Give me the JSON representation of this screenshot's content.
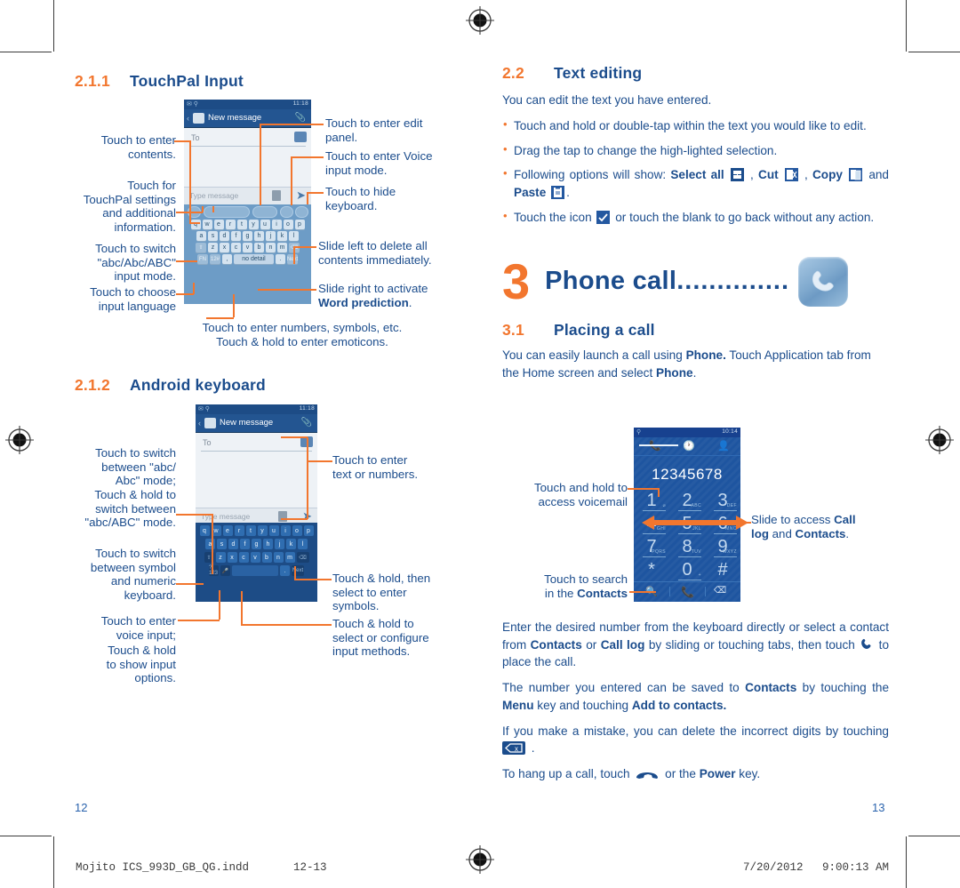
{
  "marks": {
    "registration": "registration-crosshair"
  },
  "left_column": {
    "section1": {
      "number": "2.1.1",
      "title": "TouchPal Input"
    },
    "section2": {
      "number": "2.1.2",
      "title": "Android keyboard"
    },
    "touchpal_phone": {
      "status_time": "11:18",
      "title": "New message",
      "to_placeholder": "To",
      "type_placeholder": "Type message",
      "keys_row1": [
        "q",
        "w",
        "e",
        "r",
        "t",
        "y",
        "u",
        "i",
        "o",
        "p"
      ],
      "keys_row2": [
        "a",
        "s",
        "d",
        "f",
        "g",
        "h",
        "j",
        "k",
        "l"
      ],
      "keys_row3": [
        "z",
        "x",
        "c",
        "v",
        "b",
        "n",
        "m"
      ],
      "key_fn": "FN",
      "key_123": "12#",
      "key_next": "Next",
      "key_space": "no detail"
    },
    "android_phone": {
      "status_time": "11:18",
      "title": "New message",
      "to_placeholder": "To",
      "type_placeholder": "Type message",
      "keys_row1": [
        "q",
        "w",
        "e",
        "r",
        "t",
        "y",
        "u",
        "i",
        "o",
        "p"
      ],
      "keys_row2": [
        "a",
        "s",
        "d",
        "f",
        "g",
        "h",
        "j",
        "k",
        "l"
      ],
      "keys_row3": [
        "z",
        "x",
        "c",
        "v",
        "b",
        "n",
        "m"
      ],
      "key_sym": "?123",
      "key_next": "Next",
      "key_period": "."
    },
    "callouts": [
      {
        "id": "enter-contents",
        "text": "Touch to enter\ncontents."
      },
      {
        "id": "touchpal-settings",
        "text": "Touch for\nTouchPal settings\nand additional\ninformation."
      },
      {
        "id": "switch-abc",
        "text": "Touch to switch\n\"abc/Abc/ABC\"\ninput mode."
      },
      {
        "id": "choose-language",
        "text": "Touch to choose\ninput language"
      },
      {
        "id": "enter-edit-panel",
        "text": "Touch to enter edit\npanel."
      },
      {
        "id": "voice-input-mode",
        "text": "Touch to enter Voice\ninput mode."
      },
      {
        "id": "hide-keyboard",
        "text": "Touch to hide\nkeyboard."
      },
      {
        "id": "slide-left-delete",
        "text": "Slide left to delete all\ncontents immediately."
      },
      {
        "id": "slide-right-word",
        "text": "Slide right to activate"
      },
      {
        "id": "slide-right-word-bold",
        "text": "Word prediction"
      },
      {
        "id": "numbers-symbols-1",
        "text": "Touch to enter numbers, symbols, etc."
      },
      {
        "id": "numbers-symbols-2",
        "text": "Touch & hold to enter emoticons."
      },
      {
        "id": "switch-abc-android",
        "text": "Touch to switch\nbetween \"abc/\nAbc\" mode;\nTouch & hold to\nswitch between\n\"abc/ABC\" mode."
      },
      {
        "id": "switch-symbol-numeric",
        "text": "Touch to switch\nbetween symbol\nand numeric\nkeyboard."
      },
      {
        "id": "voice-input",
        "text": "Touch to enter\nvoice input;"
      },
      {
        "id": "show-input-options",
        "text": "Touch & hold\nto show input\noptions."
      },
      {
        "id": "enter-text-numbers",
        "text": "Touch to enter\ntext or numbers."
      },
      {
        "id": "hold-select-symbols",
        "text": "Touch & hold, then\nselect to enter\nsymbols."
      },
      {
        "id": "configure-input",
        "text": "Touch & hold to\nselect or configure\ninput methods."
      }
    ]
  },
  "right_column": {
    "section_text_editing": {
      "number": "2.2",
      "title": "Text editing"
    },
    "intro": "You can edit the text you have entered.",
    "bullets": [
      {
        "parts": [
          {
            "t": "Touch and hold or double-tap within the text you would like to edit.",
            "b": false
          }
        ]
      },
      {
        "parts": [
          {
            "t": "Drag the tap to change the high-lighted selection.",
            "b": false
          }
        ]
      },
      {
        "parts": [
          {
            "t": "Following options will show: ",
            "b": false
          },
          {
            "t": "Select all",
            "b": true
          },
          {
            "t": " ",
            "b": false
          },
          {
            "icon": "select-all-icon"
          },
          {
            "t": " , ",
            "b": false
          },
          {
            "t": "Cut",
            "b": true
          },
          {
            "t": " ",
            "b": false
          },
          {
            "icon": "cut-icon"
          },
          {
            "t": " , ",
            "b": false
          },
          {
            "t": "Copy",
            "b": true
          },
          {
            "t": " ",
            "b": false
          },
          {
            "icon": "copy-icon"
          },
          {
            "t": " and ",
            "b": false
          },
          {
            "t": "Paste",
            "b": true
          },
          {
            "t": " ",
            "b": false
          },
          {
            "icon": "paste-icon"
          },
          {
            "t": ".",
            "b": false
          }
        ]
      },
      {
        "parts": [
          {
            "t": "Touch the icon ",
            "b": false
          },
          {
            "icon": "check-icon"
          },
          {
            "t": " or touch the blank to go back without any action.",
            "b": false
          }
        ]
      }
    ],
    "chapter": {
      "number": "3",
      "title": "Phone call",
      "dots": "..............",
      "icon": "phone-handset-icon"
    },
    "section_placing": {
      "number": "3.1",
      "title": "Placing a call"
    },
    "placing_intro_parts": [
      {
        "t": "You can easily launch a call using ",
        "b": false
      },
      {
        "t": "Phone.",
        "b": true
      },
      {
        "t": " Touch Application tab from the Home screen and select ",
        "b": false
      },
      {
        "t": "Phone",
        "b": true
      },
      {
        "t": ".",
        "b": false
      }
    ],
    "dialer": {
      "status_time": "10:14",
      "tabs": [
        "phone-icon",
        "clock-icon",
        "contacts-icon"
      ],
      "number": "12345678",
      "keys": [
        {
          "d": "1",
          "s": "⌀"
        },
        {
          "d": "2",
          "s": "ABC"
        },
        {
          "d": "3",
          "s": "DEF"
        },
        {
          "d": "4",
          "s": "GHI"
        },
        {
          "d": "5",
          "s": "JKL"
        },
        {
          "d": "6",
          "s": "MNO"
        },
        {
          "d": "7",
          "s": "PQRS"
        },
        {
          "d": "8",
          "s": "TUV"
        },
        {
          "d": "9",
          "s": "WXYZ"
        },
        {
          "d": "*",
          "s": ""
        },
        {
          "d": "0",
          "s": "+"
        },
        {
          "d": "#",
          "s": ""
        }
      ],
      "bottom": [
        "search-icon",
        "call-icon",
        "backspace-icon"
      ]
    },
    "dialer_callouts": [
      {
        "id": "voicemail",
        "text": "Touch and hold to\naccess voicemail"
      },
      {
        "id": "search-contacts-l1",
        "text": "Touch to search"
      },
      {
        "id": "search-contacts-l2",
        "text": "in the "
      },
      {
        "id": "search-contacts-bold",
        "text": "Contacts"
      },
      {
        "id": "slide-access-1",
        "text": "Slide to access "
      },
      {
        "id": "slide-access-b1",
        "text": "Call"
      },
      {
        "id": "slide-access-b2",
        "text": "log"
      },
      {
        "id": "slide-access-2",
        "text": " and "
      },
      {
        "id": "slide-access-b3",
        "text": "Contacts"
      },
      {
        "id": "slide-access-3",
        "text": "."
      }
    ],
    "para_enter_parts": [
      {
        "t": "Enter the desired number from the keyboard directly or select a contact from ",
        "b": false
      },
      {
        "t": "Contacts",
        "b": true
      },
      {
        "t": " or ",
        "b": false
      },
      {
        "t": "Call log",
        "b": true
      },
      {
        "t": " by sliding or touching tabs, then touch ",
        "b": false
      },
      {
        "icon": "call-icon"
      },
      {
        "t": " to place the call.",
        "b": false
      }
    ],
    "para_save_parts": [
      {
        "t": "The number you entered can be saved to ",
        "b": false
      },
      {
        "t": "Contacts",
        "b": true
      },
      {
        "t": " by touching the ",
        "b": false
      },
      {
        "t": "Menu",
        "b": true
      },
      {
        "t": " key and touching ",
        "b": false
      },
      {
        "t": "Add to contacts.",
        "b": true
      }
    ],
    "para_mistake_parts": [
      {
        "t": "If you make a mistake, you can delete the incorrect digits by touching ",
        "b": false
      },
      {
        "icon": "backspace-icon"
      },
      {
        "t": " .",
        "b": false
      }
    ],
    "para_hangup_parts": [
      {
        "t": "To hang up a call, touch ",
        "b": false
      },
      {
        "icon": "hangup-icon"
      },
      {
        "t": " or the ",
        "b": false
      },
      {
        "t": "Power",
        "b": true
      },
      {
        "t": " key.",
        "b": false
      }
    ]
  },
  "footer": {
    "page_left": "12",
    "page_right": "13",
    "file_name": "Mojito ICS_993D_GB_QG.indd",
    "spread": "12-13",
    "date": "7/20/2012",
    "time": "9:00:13 AM"
  },
  "colors": {
    "accent_orange": "#f2762e",
    "text_blue": "#1b4c8c",
    "phone_chrome": "#1d4c86",
    "dialer_bg": "#1e55a0"
  }
}
